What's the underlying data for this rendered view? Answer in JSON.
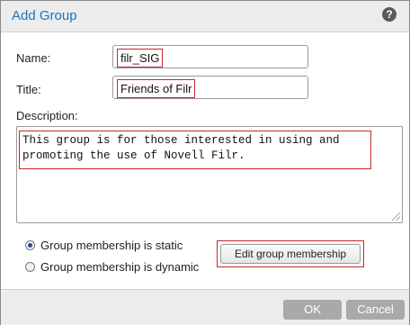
{
  "dialog": {
    "title": "Add Group",
    "help_icon": "?"
  },
  "form": {
    "name_label": "Name:",
    "name_value": "filr_SIG",
    "title_label": "Title:",
    "title_value": "Friends of Filr",
    "description_label": "Description:",
    "description_value": "This group is for those interested in using and\npromoting the use of Novell Filr."
  },
  "membership": {
    "static_label": "Group membership is static",
    "dynamic_label": "Group membership is dynamic",
    "selected": "static",
    "edit_button_label": "Edit group membership"
  },
  "footer": {
    "ok_label": "OK",
    "cancel_label": "Cancel"
  },
  "colors": {
    "title": "#1b75bb",
    "highlight_border": "#c8262c",
    "button_disabled": "#a9a9a9"
  }
}
